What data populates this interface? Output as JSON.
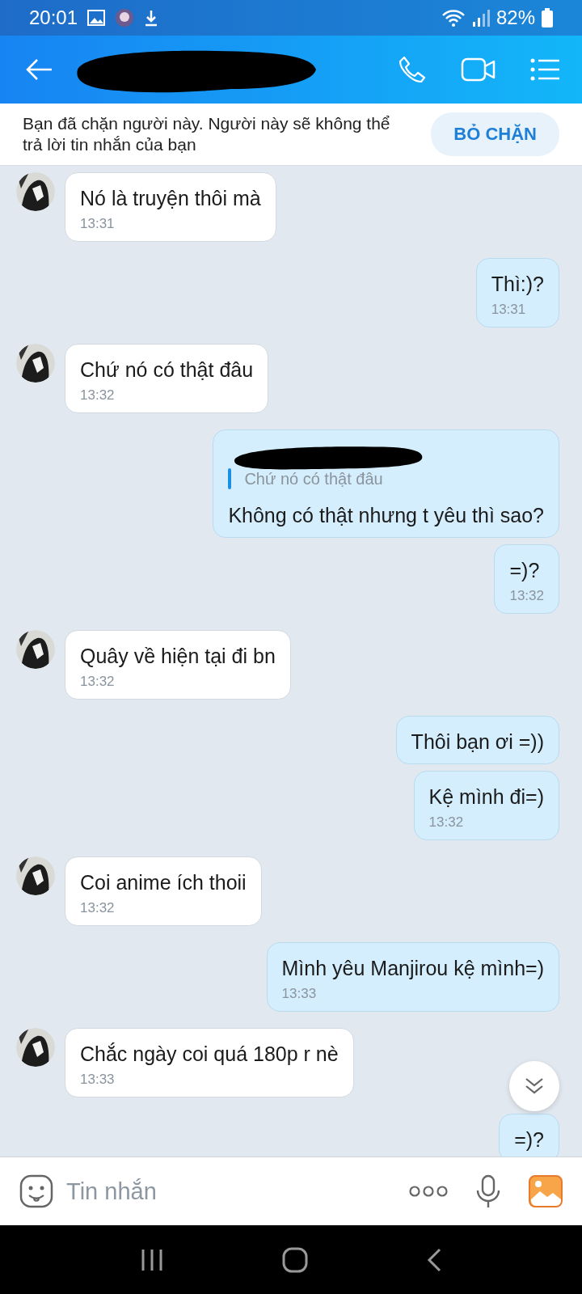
{
  "status_bar": {
    "time": "20:01",
    "battery": "82%"
  },
  "banner": {
    "text": "Bạn đã chặn người này. Người này sẽ không thể trả lời tin nhắn của bạn",
    "button": "BỎ CHẶN"
  },
  "messages": [
    {
      "kind": "received",
      "text": "Nó là truyện thôi mà",
      "time": "13:31"
    },
    {
      "kind": "sent",
      "text": "Thì:)?",
      "time": "13:31"
    },
    {
      "kind": "received",
      "text": "Chứ nó có thật đâu",
      "time": "13:32"
    },
    {
      "kind": "reply",
      "quote": "Chứ nó có thật đâu",
      "text": "Không có thật nhưng t yêu thì sao?"
    },
    {
      "kind": "sent",
      "text": "=)?",
      "time": "13:32"
    },
    {
      "kind": "received",
      "text": "Quây về hiện tại đi bn",
      "time": "13:32"
    },
    {
      "kind": "sent",
      "text": "Thôi bạn ơi =))"
    },
    {
      "kind": "sent",
      "text": "Kệ mình đi=)",
      "time": "13:32"
    },
    {
      "kind": "received",
      "text": "Coi anime ích thoii",
      "time": "13:32"
    },
    {
      "kind": "sent",
      "text": "Mình yêu Manjirou kệ mình=)",
      "time": "13:33"
    },
    {
      "kind": "received",
      "text": "Chắc ngày coi quá 180p r nè",
      "time": "13:33"
    },
    {
      "kind": "sent",
      "text": "=)?"
    }
  ],
  "composer": {
    "placeholder": "Tin nhắn"
  }
}
